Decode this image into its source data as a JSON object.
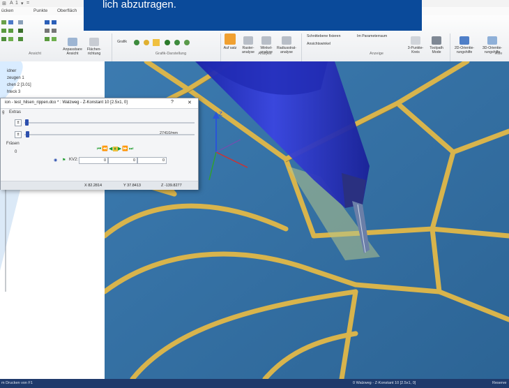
{
  "callout": {
    "text": "lich abzutragen."
  },
  "quick_access": {
    "items": [
      "⊞",
      "A",
      "1",
      "▾",
      "="
    ]
  },
  "menu": {
    "tabs": [
      "ücken",
      "Punkte",
      "Oberfläch"
    ]
  },
  "ribbon": {
    "groups": [
      {
        "label": "Ansicht"
      },
      {
        "label": "Grafik-Darstellung"
      },
      {
        "label": "Analyse"
      },
      {
        "label": "Anzeige"
      },
      {
        "label": "Hilfe"
      }
    ],
    "buttons": {
      "anpassbare_ansicht": "Anpassbare Ansicht",
      "flaechenrichtung": "Flächen-richtung",
      "grafik": "Grafik",
      "aufsatz": "Auf satz",
      "rasteranalyse": "Raster-analyse",
      "winkelanalyse": "Winkel-analyse",
      "radiusanalyse": "Radiusstrat-analyse",
      "schnittebene": "Schnittebene fixieren",
      "ansichtswinkel": "Ansichtswinkel",
      "im_parameterraum": "Im Parameterraum",
      "dreipunktekreis": "3-Punkte-Kreis",
      "toolpath_mode": "Toolpath Mode",
      "zwei_d_orientierungshilfe": "2D-Orientie-rungshilfe",
      "drei_d_orientierungshilfe": "3D-Orientie-rungshilfe"
    }
  },
  "tree": {
    "items": [
      "idner",
      "zeugen 1",
      "chen 2 [3.01]",
      "hteck 3"
    ]
  },
  "dialog": {
    "title": "ion - test_hilsen_rippen.dco * : Walzweg - Z-Konstant 10 [2.5x1, 0]",
    "help": "?",
    "close": "✕",
    "menu_items": [
      "g",
      "Extras"
    ],
    "slider_value": "27410/mm",
    "fraesen_label": "Fräsen",
    "counter": "0",
    "kv_label": "KV2:",
    "values": [
      "0",
      "0",
      "0"
    ],
    "coords": [
      "X 82.2814",
      "Y 37.8413",
      "Z -139.8277"
    ]
  },
  "statusbar": {
    "left": "m Drucken von F1",
    "center": "0   Walzweg - Z-Konstant 10 [2.5x1, 0]",
    "right": "Reserve"
  },
  "colors": {
    "accent": "#0a4a9a",
    "background_blue": "#2e6aa0",
    "rib_gold": "#d7b24a",
    "tool_blue": "#2c36c9",
    "playback_green": "#1a9a28"
  }
}
